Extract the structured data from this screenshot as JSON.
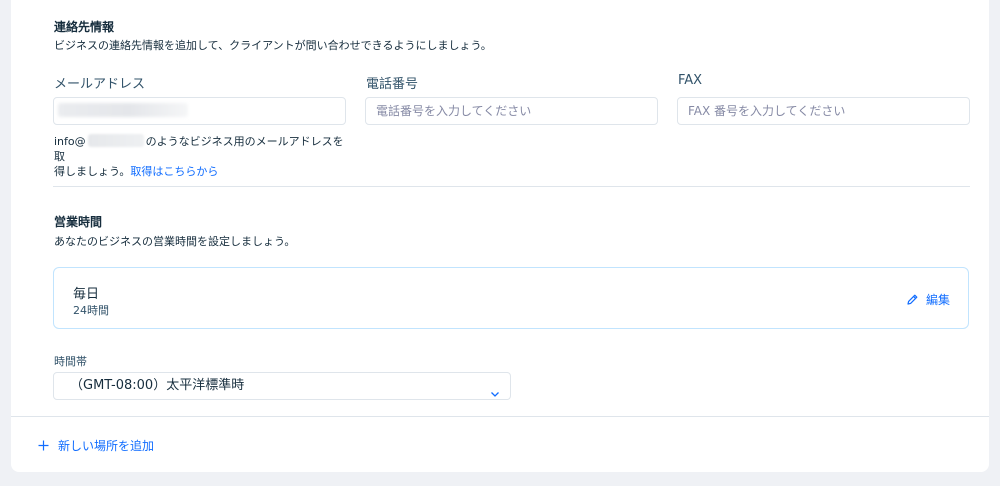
{
  "contact": {
    "title": "連絡先情報",
    "description": "ビジネスの連絡先情報を追加して、クライアントが問い合わせできるようにしましょう。",
    "email_label": "メールアドレス",
    "email_value": "",
    "phone_label": "電話番号",
    "phone_placeholder": "電話番号を入力してください",
    "fax_label": "FAX",
    "fax_placeholder": "FAX 番号を入力してください",
    "email_hint_prefix": "info@",
    "email_hint_middle": "のようなビジネス用のメールアドレスを取",
    "email_hint_line2": "得しましょう。",
    "email_hint_link": "取得はこちらから"
  },
  "hours": {
    "title": "営業時間",
    "description": "あなたのビジネスの営業時間を設定しましょう。",
    "day_label": "毎日",
    "duration": "24時間",
    "edit_label": "編集"
  },
  "timezone": {
    "label": "時間帯",
    "selected": "（GMT-08:00）太平洋標準時"
  },
  "footer": {
    "add_location_label": "新しい場所を追加"
  },
  "colors": {
    "accent": "#116dff",
    "text": "#162d3d",
    "border": "#dfe5eb",
    "selected_border": "#c1e4fe",
    "page_bg": "#eff1f5"
  },
  "icons": {
    "edit": "pencil-icon",
    "select": "chevron-down-icon",
    "add": "plus-icon"
  }
}
